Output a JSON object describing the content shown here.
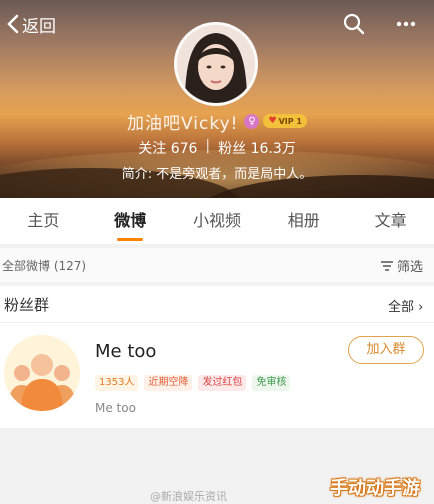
{
  "header": {
    "back_label": "返回",
    "name": "加油吧Vicky!",
    "vip_label": "VIP 1",
    "stats": {
      "following_label": "关注",
      "following_value": "676",
      "fans_label": "粉丝",
      "fans_value": "16.3万"
    },
    "bio": "简介: 不是旁观者，而是局中人。"
  },
  "tabs": [
    "主页",
    "微博",
    "小视频",
    "相册",
    "文章"
  ],
  "active_tab": "微博",
  "weibo_list": {
    "all_label": "全部微博 (127)",
    "filter_label": "筛选"
  },
  "fans_group": {
    "title": "粉丝群",
    "all_link": "全部",
    "group": {
      "name": "Me too",
      "join_label": "加入群",
      "tags": [
        "1353人",
        "近期空降",
        "发过红包",
        "免审核"
      ],
      "subtitle": "Me too"
    }
  },
  "footer": {
    "watermark": "@新浪娱乐资讯",
    "brand": "手动动手游"
  },
  "colors": {
    "accent": "#ff8200",
    "join_border": "#e1a24d"
  }
}
